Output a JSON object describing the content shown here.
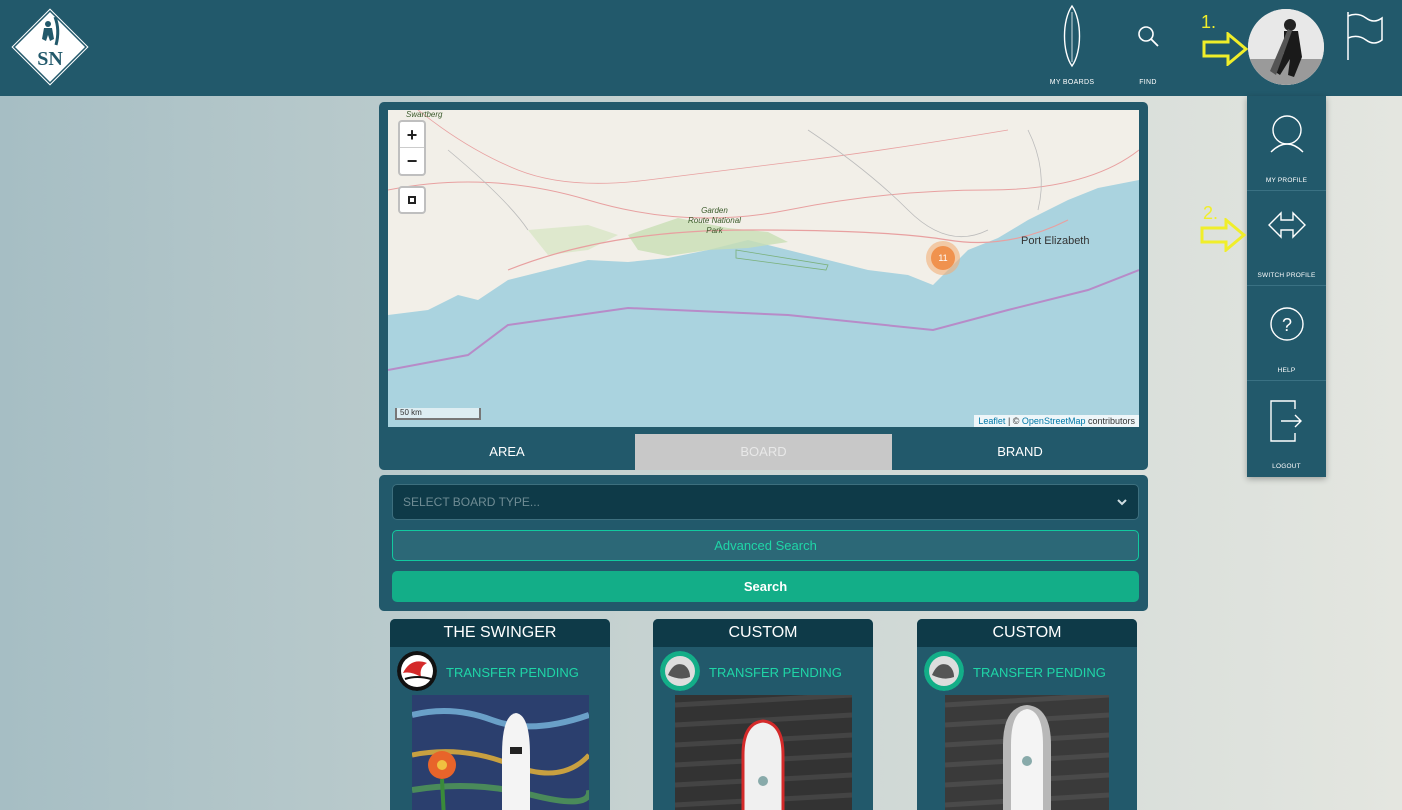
{
  "header": {
    "logo_text": "SN",
    "nav": [
      {
        "label": "MY BOARDS",
        "icon": "surfboard-icon"
      },
      {
        "label": "FIND",
        "icon": "search-icon"
      }
    ],
    "avatar_icon": "user-avatar",
    "flag_icon": "flag-icon"
  },
  "annotations": {
    "step1": "1.",
    "step2": "2.",
    "color": "#f0ee2a"
  },
  "profile_menu": {
    "items": [
      {
        "label": "MY PROFILE",
        "icon": "user-icon"
      },
      {
        "label": "SWITCH PROFILE",
        "icon": "switch-arrows-icon"
      },
      {
        "label": "HELP",
        "icon": "help-icon"
      },
      {
        "label": "LOGOUT",
        "icon": "logout-icon"
      }
    ]
  },
  "map": {
    "zoom_in": "+",
    "zoom_out": "−",
    "labels": {
      "reserve": "Swartberg\nature\nerve",
      "park": "Garden\nRoute National\nPark",
      "city": "Port Elizabeth"
    },
    "cluster_count": "11",
    "scale": "50 km",
    "attribution": {
      "leaflet": "Leaflet",
      "sep": " | © ",
      "osm": "OpenStreetMap",
      "suffix": " contributors"
    }
  },
  "tabs": [
    {
      "label": "AREA",
      "active": false
    },
    {
      "label": "BOARD",
      "active": true
    },
    {
      "label": "BRAND",
      "active": false
    }
  ],
  "search": {
    "select_placeholder": "SELECT BOARD TYPE...",
    "advanced_label": "Advanced Search",
    "search_label": "Search"
  },
  "cards": [
    {
      "title": "THE SWINGER",
      "status": "TRANSFER PENDING"
    },
    {
      "title": "CUSTOM",
      "status": "TRANSFER PENDING"
    },
    {
      "title": "CUSTOM",
      "status": "TRANSFER PENDING"
    }
  ],
  "colors": {
    "primary": "#22596b",
    "dark": "#0e3a48",
    "accent": "#13ae88",
    "accent_text": "#1fd6a7"
  }
}
